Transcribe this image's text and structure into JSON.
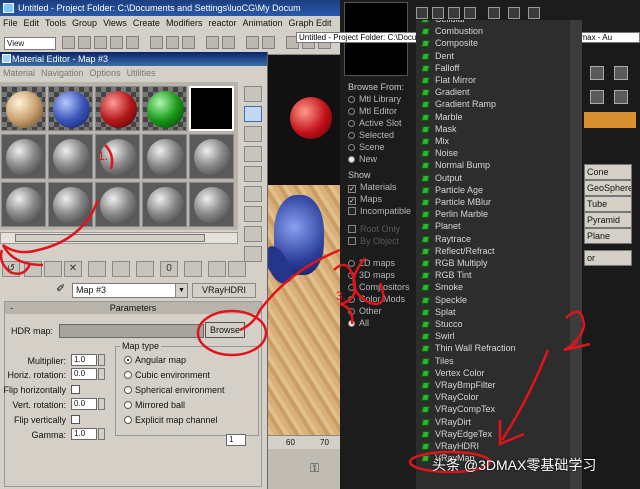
{
  "max_window": {
    "title": "Untitled",
    "title_suffix": "- Project Folder: C:\\Documents and Settings\\luoCG\\My Docum",
    "menu": [
      "File",
      "Edit",
      "Tools",
      "Group",
      "Views",
      "Create",
      "Modifiers",
      "reactor",
      "Animation",
      "Graph Edit"
    ],
    "view_dropdown": "View"
  },
  "tooltip_title": "Untitled   - Project Folder: C:\\Documents and Settings\\luoCG\\My Documents\\3dsmax   - Au",
  "material_editor": {
    "title": "Material Editor - Map #3",
    "menu": [
      "Material",
      "Navigation",
      "Options",
      "Utilities"
    ],
    "map_name": "Map #3",
    "map_type_button": "VRayHDRI",
    "parameters_header": "Parameters",
    "params_minus": "-",
    "hdr_map_label": "HDR map:",
    "browse_label": "Browse",
    "multiplier_label": "Multiplier:",
    "multiplier_value": "1.0",
    "horiz_rotation_label": "Horiz. rotation:",
    "horiz_rotation_value": "0.0",
    "flip_h_label": "Flip horizontally",
    "vert_rotation_label": "Vert. rotation:",
    "vert_rotation_value": "0.0",
    "flip_v_label": "Flip vertically",
    "gamma_label": "Gamma:",
    "gamma_value": "1.0",
    "map_type_title": "Map type",
    "map_types": [
      "Angular map",
      "Cubic environment",
      "Spherical environment",
      "Mirrored ball",
      "Explicit map channel"
    ],
    "map_type_selected": "Angular map",
    "explicit_channel_value": "1"
  },
  "browser": {
    "browse_from_title": "Browse From:",
    "browse_from": [
      "Mtl Library",
      "Mtl Editor",
      "Active Slot",
      "Selected",
      "Scene",
      "New"
    ],
    "browse_from_selected": "New",
    "show_title": "Show",
    "show": [
      {
        "label": "Materials",
        "checked": true,
        "dim": false
      },
      {
        "label": "Maps",
        "checked": true,
        "dim": false
      },
      {
        "label": "Incompatible",
        "checked": false,
        "dim": false
      },
      {
        "label": "Root Only",
        "checked": false,
        "dim": true
      },
      {
        "label": "By Object",
        "checked": false,
        "dim": true
      }
    ],
    "types": [
      "2D maps",
      "3D maps",
      "Compositors",
      "Color Mods",
      "Other",
      "All"
    ],
    "types_selected": "All",
    "maps": [
      "Cellular",
      "Combustion",
      "Composite",
      "Dent",
      "Falloff",
      "Flat Mirror",
      "Gradient",
      "Gradient Ramp",
      "Marble",
      "Mask",
      "Mix",
      "Noise",
      "Normal Bump",
      "Output",
      "Particle Age",
      "Particle MBlur",
      "Perlin Marble",
      "Planet",
      "Raytrace",
      "Reflect/Refract",
      "RGB Multiply",
      "RGB Tint",
      "Smoke",
      "Speckle",
      "Splat",
      "Stucco",
      "Swirl",
      "Thin Wall Refraction",
      "Tiles",
      "Vertex Color",
      "VRayBmpFilter",
      "VRayColor",
      "VRayCompTex",
      "VRayDirt",
      "VRayEdgeTex",
      "VRayHDRI",
      "VRayMap"
    ]
  },
  "command_panel": {
    "buttons": [
      "Cone",
      "GeoSphere",
      "Tube",
      "Pyramid",
      "Plane",
      "or"
    ]
  },
  "timeline": {
    "tick_60": "60",
    "tick_70": "70"
  },
  "annotations": {
    "one": "1.",
    "two": "2.",
    "three": "3."
  },
  "watermark": "头条 @3DMAX零基础学习"
}
